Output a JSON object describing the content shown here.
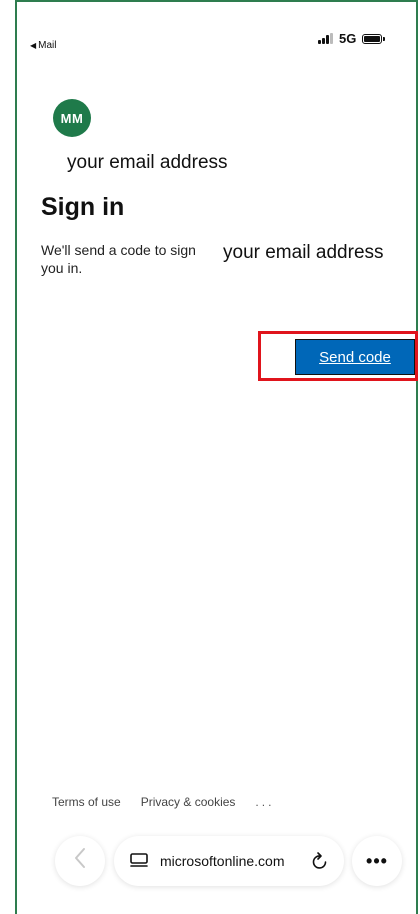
{
  "status_bar": {
    "back_app_label": "Mail",
    "network_label": "5G",
    "back_icon": "back-triangle-icon",
    "signal_icon": "signal-bars-icon",
    "battery_icon": "battery-icon"
  },
  "account": {
    "avatar_initials": "MM",
    "avatar_color": "#1f7a4a",
    "email_display": "your email address"
  },
  "signin": {
    "title": "Sign in",
    "description": "We'll send a code to sign you in.",
    "email_display": "your email address",
    "send_code_label": "Send code",
    "button_color": "#0067b8",
    "highlight_color": "#e0141c"
  },
  "footer": {
    "terms_label": "Terms of use",
    "privacy_label": "Privacy & cookies",
    "more_label": "..."
  },
  "browser": {
    "url": "microsoftonline.com",
    "menu_label": "•••",
    "back_icon": "chevron-left-icon",
    "tabs_icon": "tabs-icon",
    "reload_icon": "reload-icon"
  }
}
